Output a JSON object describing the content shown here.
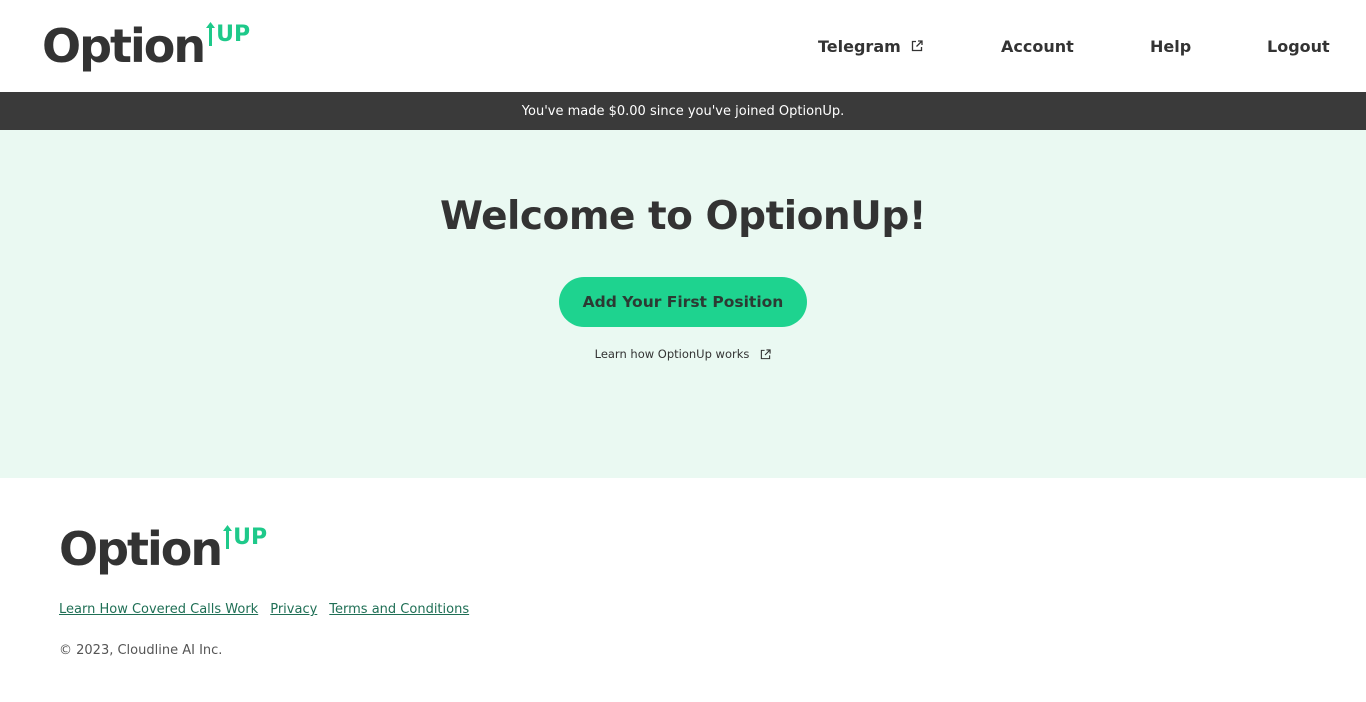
{
  "brand": {
    "name_main": "Option",
    "name_accent": "UP",
    "accent_color": "#1ec98a",
    "dark_color": "#333333"
  },
  "nav": {
    "telegram": "Telegram",
    "account": "Account",
    "help": "Help",
    "logout": "Logout"
  },
  "banner": {
    "text": "You've made $0.00 since you've joined OptionUp."
  },
  "hero": {
    "title": "Welcome to OptionUp!",
    "cta_label": "Add Your First Position",
    "learn_link": "Learn how OptionUp works"
  },
  "footer": {
    "links": [
      "Learn How Covered Calls Work",
      "Privacy",
      "Terms and Conditions"
    ],
    "copyright": "© 2023, Cloudline AI Inc."
  },
  "icons": {
    "external": "external-link-icon",
    "logo_arrow": "up-arrow-icon"
  }
}
